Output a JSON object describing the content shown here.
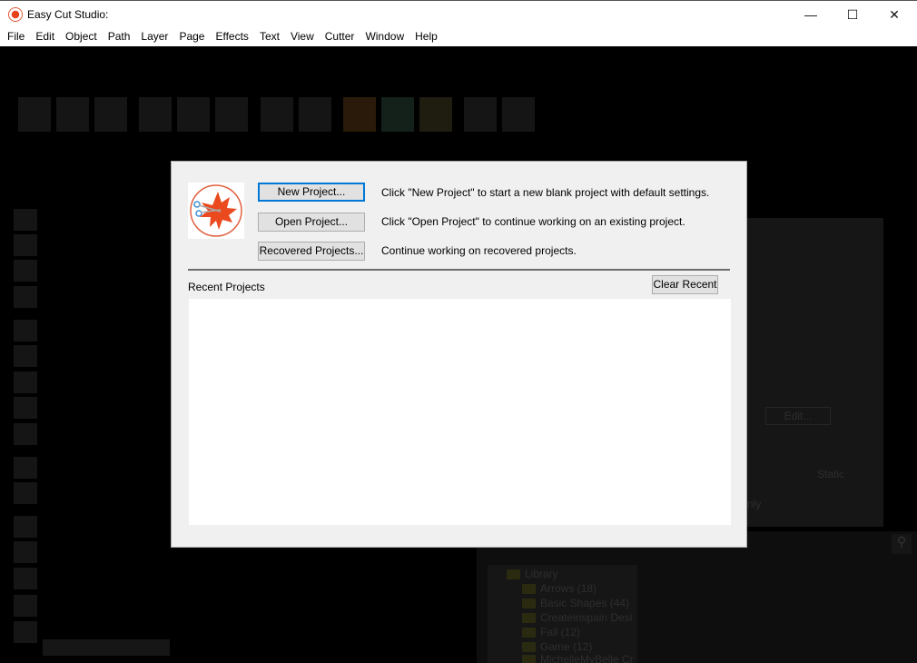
{
  "window": {
    "title": "Easy Cut Studio:",
    "controls": [
      "minimize",
      "maximize",
      "close"
    ]
  },
  "menu": [
    "File",
    "Edit",
    "Object",
    "Path",
    "Layer",
    "Page",
    "Effects",
    "Text",
    "View",
    "Cutter",
    "Window",
    "Help"
  ],
  "dialog": {
    "new_project": {
      "label": "New Project...",
      "description": "Click \"New Project\" to start a new blank project with default settings."
    },
    "open_project": {
      "label": "Open Project...",
      "description": "Click \"Open Project\" to continue working on an existing project."
    },
    "recovered_projects": {
      "label": "Recovered Projects...",
      "description": "Continue working on recovered projects."
    },
    "recent_label": "Recent Projects",
    "clear_recent": "Clear Recent",
    "recent_items": []
  },
  "background": {
    "edit_button": "Edit...",
    "static_label": "Static",
    "only_fragment": "nly",
    "library": {
      "root": "Library",
      "items": [
        "Arrows (18)",
        "Basic Shapes (44)",
        "Createinspain Desi",
        "Fall (12)",
        "Game (12)",
        "MichelleMyBelle Cr"
      ]
    }
  },
  "colors": {
    "accent": "#0078d7",
    "logo": "#e8401c",
    "dialog_bg": "#f0f0f0"
  }
}
